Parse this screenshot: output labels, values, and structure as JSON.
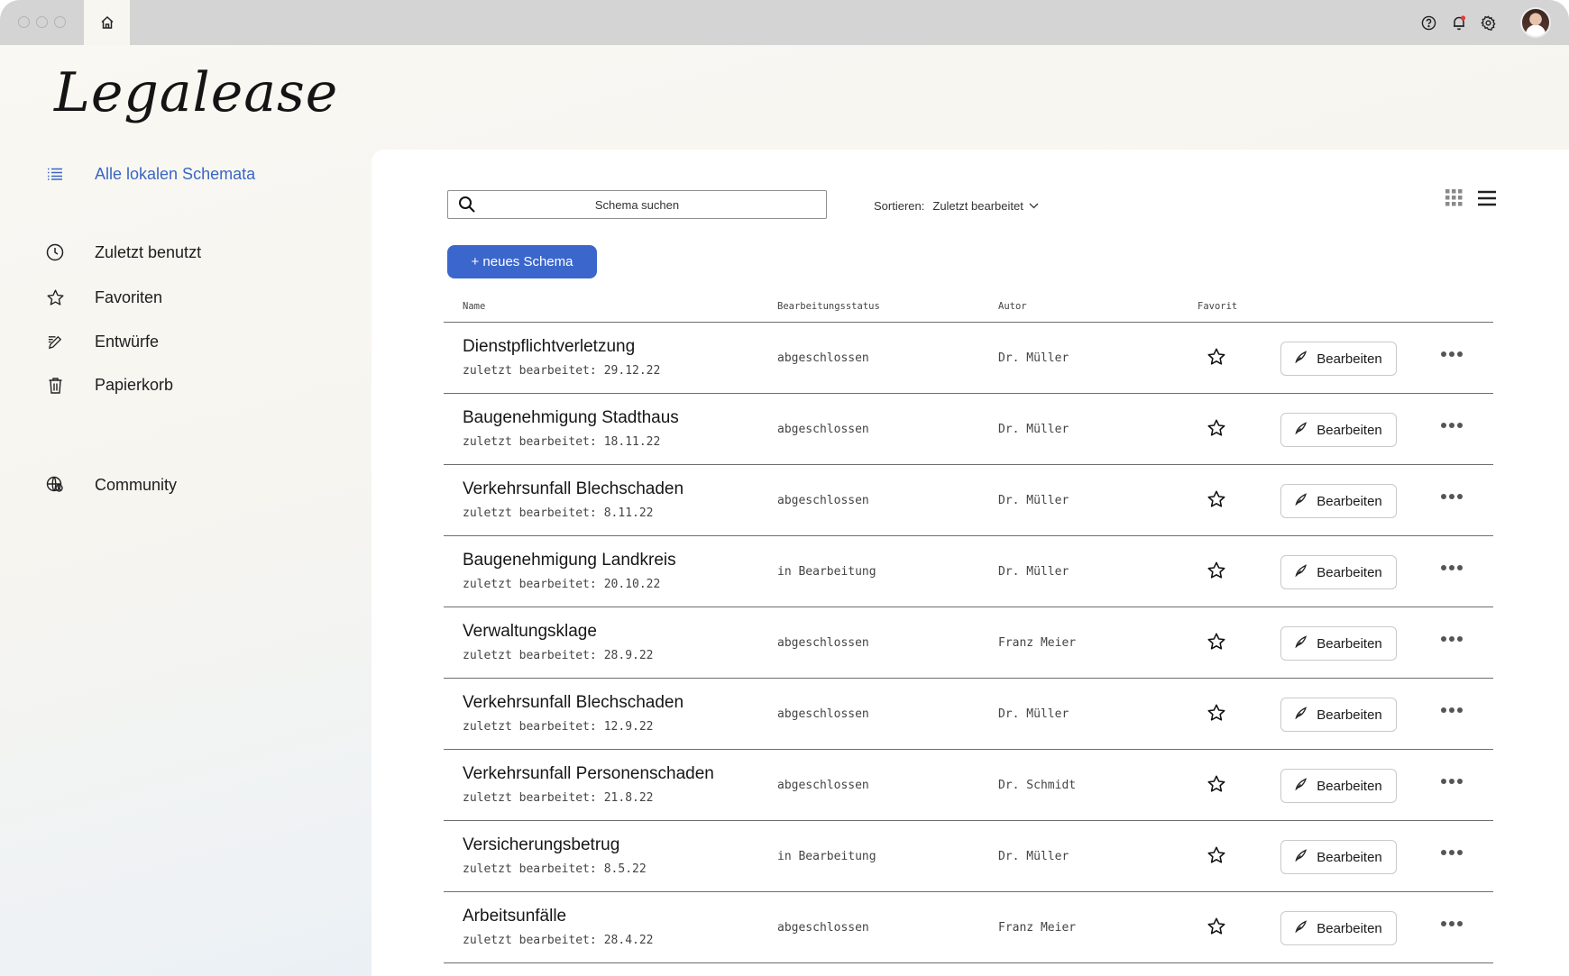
{
  "app": {
    "logo_text": "Legalease"
  },
  "chrome": {
    "icons": [
      "home-icon",
      "help-icon",
      "bell-icon",
      "gear-icon",
      "avatar"
    ],
    "notification_dot_color": "#e53935"
  },
  "sidebar": {
    "items": [
      {
        "label": "Alle lokalen Schemata",
        "icon": "list-icon",
        "active": true
      },
      {
        "label": "Zuletzt benutzt",
        "icon": "clock-icon"
      },
      {
        "label": "Favoriten",
        "icon": "star-icon"
      },
      {
        "label": "Entwürfe",
        "icon": "pencil-lines-icon"
      },
      {
        "label": "Papierkorb",
        "icon": "trash-icon"
      },
      {
        "label": "Community",
        "icon": "globe-user-icon"
      }
    ],
    "active_color": "#3a66c4"
  },
  "toolbar": {
    "search_placeholder": "Schema suchen",
    "sort_label": "Sortieren:",
    "sort_value": "Zuletzt bearbeitet",
    "new_button": "+ neues Schema",
    "accent_color": "#3b66cc"
  },
  "table": {
    "headers": {
      "name": "Name",
      "status": "Bearbeitungsstatus",
      "author": "Autor",
      "favorite": "Favorit"
    },
    "edited_prefix": "zuletzt bearbeitet:",
    "edit_label": "Bearbeiten",
    "rows": [
      {
        "name": "Dienstpflichtverletzung",
        "date": "29.12.22",
        "status": "abgeschlossen",
        "author": "Dr. Müller"
      },
      {
        "name": "Baugenehmigung Stadthaus",
        "date": "18.11.22",
        "status": "abgeschlossen",
        "author": "Dr. Müller"
      },
      {
        "name": "Verkehrsunfall Blechschaden",
        "date": "8.11.22",
        "status": "abgeschlossen",
        "author": "Dr. Müller"
      },
      {
        "name": "Baugenehmigung Landkreis",
        "date": "20.10.22",
        "status": "in Bearbeitung",
        "author": "Dr. Müller"
      },
      {
        "name": "Verwaltungsklage",
        "date": "28.9.22",
        "status": "abgeschlossen",
        "author": "Franz Meier"
      },
      {
        "name": "Verkehrsunfall Blechschaden",
        "date": "12.9.22",
        "status": "abgeschlossen",
        "author": "Dr. Müller"
      },
      {
        "name": "Verkehrsunfall Personenschaden",
        "date": "21.8.22",
        "status": "abgeschlossen",
        "author": "Dr. Schmidt"
      },
      {
        "name": "Versicherungsbetrug",
        "date": "8.5.22",
        "status": "in Bearbeitung",
        "author": "Dr. Müller"
      },
      {
        "name": "Arbeitsunfälle",
        "date": "28.4.22",
        "status": "abgeschlossen",
        "author": "Franz Meier"
      }
    ]
  }
}
